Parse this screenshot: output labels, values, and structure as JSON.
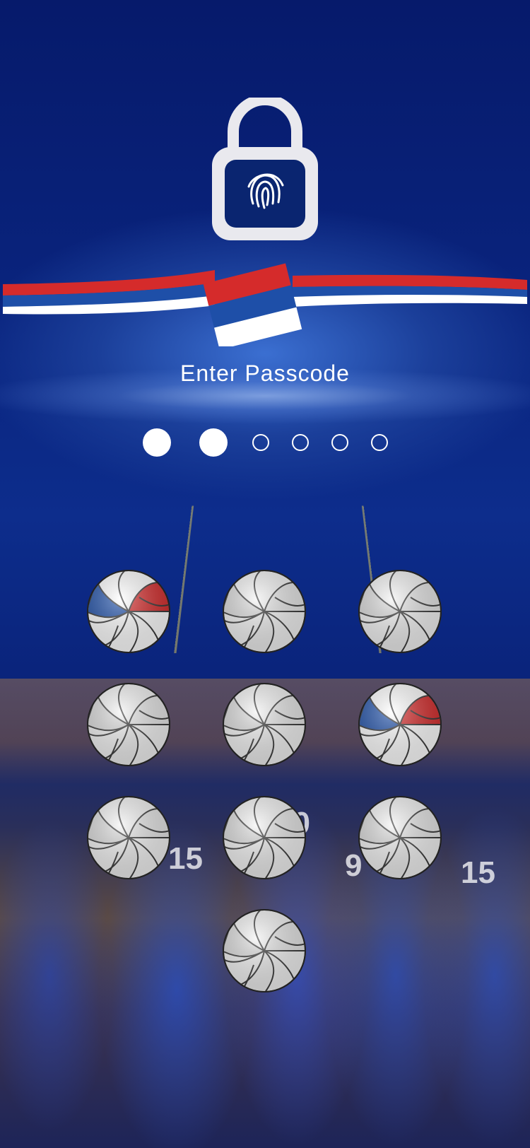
{
  "screen": {
    "title": "Enter Passcode"
  },
  "passcode": {
    "length": 6,
    "entered": 2
  },
  "keypad": {
    "keys": [
      {
        "style": "flag"
      },
      {
        "style": "white"
      },
      {
        "style": "white"
      },
      {
        "style": "white"
      },
      {
        "style": "white"
      },
      {
        "style": "flag"
      },
      {
        "style": "white"
      },
      {
        "style": "white"
      },
      {
        "style": "white"
      },
      {
        "style": "white"
      }
    ]
  },
  "icons": {
    "lock": "unlocked-padlock-fingerprint-icon",
    "ribbon": "serbian-flag-ribbon"
  },
  "colors": {
    "background": "#0a2580",
    "flag_red": "#d52b2b",
    "flag_blue": "#1e4fa8",
    "flag_white": "#ffffff"
  },
  "background_players": {
    "numbers": [
      "15",
      "20",
      "9",
      "15"
    ]
  }
}
